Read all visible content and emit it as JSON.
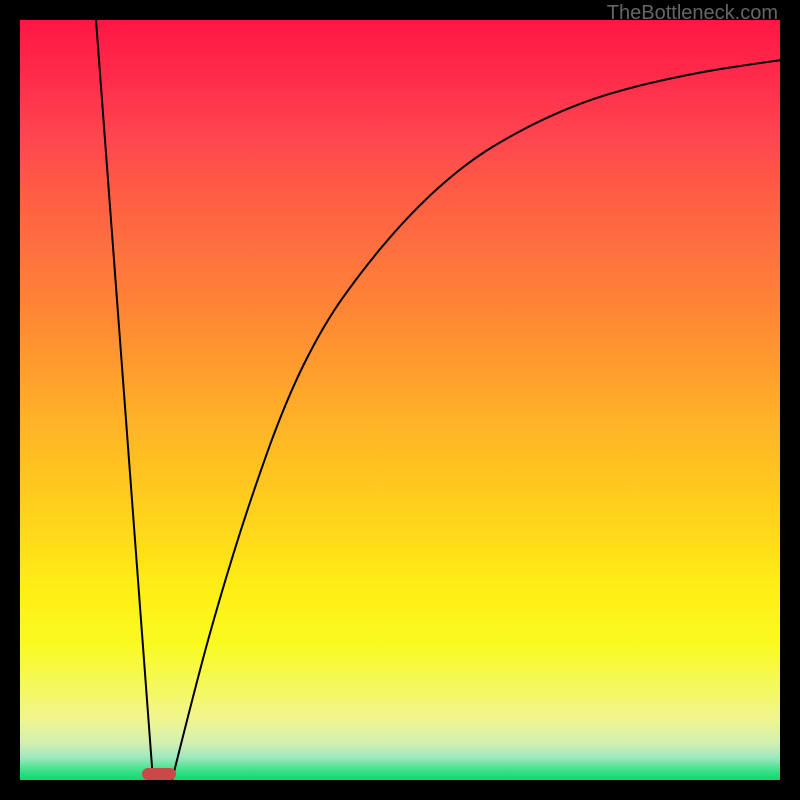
{
  "watermark": "TheBottleneck.com",
  "chart_data": {
    "type": "line",
    "title": "",
    "xlabel": "",
    "ylabel": "",
    "xlim": [
      0,
      100
    ],
    "ylim": [
      0,
      100
    ],
    "series": [
      {
        "name": "left-line",
        "x": [
          10,
          17.5
        ],
        "y": [
          100,
          0
        ]
      },
      {
        "name": "right-curve",
        "x": [
          20,
          23,
          26,
          30,
          35,
          40,
          45,
          50,
          55,
          60,
          65,
          70,
          75,
          80,
          85,
          90,
          95,
          100
        ],
        "y": [
          0,
          12,
          23,
          36,
          50,
          60,
          67,
          73,
          78,
          82,
          85,
          87.5,
          89.5,
          91,
          92.2,
          93.2,
          94,
          94.7
        ]
      }
    ],
    "marker": {
      "x_min": 16,
      "x_max": 20.5,
      "y": 0
    },
    "gradient_colors": {
      "top": "#ff1744",
      "middle": "#ffd020",
      "bottom": "#10d870"
    }
  }
}
